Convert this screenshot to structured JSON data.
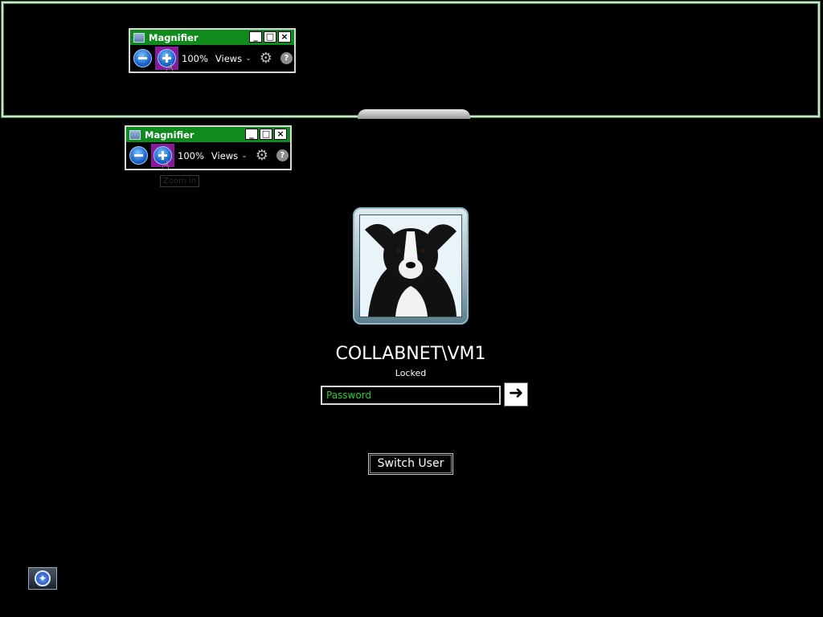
{
  "magnifier": {
    "title": "Magnifier",
    "zoom_percent": "100%",
    "views_label": "Views",
    "minimize_label": "_",
    "maximize_label": "□",
    "close_label": "×",
    "help_label": "?",
    "gear_label": "⚙",
    "chevron_label": "⌄",
    "cursor_label": "☝"
  },
  "tooltip": {
    "text": "Zoom in"
  },
  "login": {
    "username": "COLLABNET\\VM1",
    "status": "Locked",
    "password_placeholder": "Password",
    "submit_arrow": "➜",
    "switch_user_label": "Switch User"
  },
  "ease_access": {
    "icon": "ease-of-access-icon",
    "glyph": "✦"
  },
  "colors": {
    "title_bar": "#0f8a1c",
    "zoom_in_highlight": "#8a1a9c",
    "password_text": "#22d02a",
    "background": "#000000"
  }
}
